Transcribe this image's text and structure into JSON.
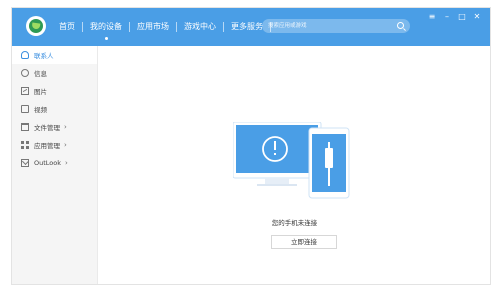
{
  "app": {
    "brand_color": "#4a9ee6",
    "accent_color": "#3b8fe0"
  },
  "nav": {
    "items": [
      {
        "label": "首页"
      },
      {
        "label": "我的设备"
      },
      {
        "label": "应用市场"
      },
      {
        "label": "游戏中心"
      },
      {
        "label": "更多服务"
      }
    ],
    "active_index": 1
  },
  "search": {
    "placeholder": "搜索应用或游戏",
    "icon": "search-icon"
  },
  "window_controls": {
    "menu": "≡",
    "minimize": "–",
    "maximize": "□",
    "close": "✕"
  },
  "sidebar": {
    "items": [
      {
        "label": "联系人",
        "icon": "person-icon",
        "active": true
      },
      {
        "label": "信息",
        "icon": "chat-icon"
      },
      {
        "label": "图片",
        "icon": "image-icon"
      },
      {
        "label": "视频",
        "icon": "video-icon"
      },
      {
        "label": "文件管理",
        "icon": "folder-icon",
        "chevron": "›"
      },
      {
        "label": "应用管理",
        "icon": "apps-icon",
        "chevron": "›"
      },
      {
        "label": "OutLook",
        "icon": "mail-icon",
        "chevron": "›"
      }
    ]
  },
  "main": {
    "status_text": "您的手机未连接",
    "connect_button": "立即连接"
  }
}
